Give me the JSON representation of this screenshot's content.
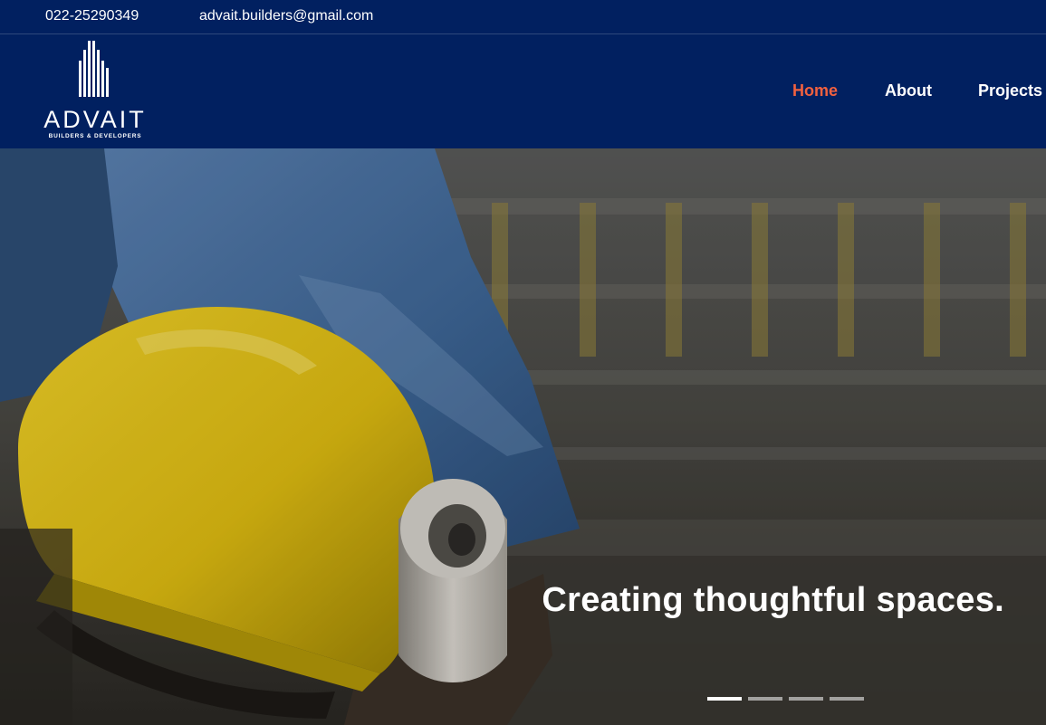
{
  "topbar": {
    "phone": "022-25290349",
    "email": "advait.builders@gmail.com"
  },
  "logo": {
    "brand": "ADVAIT",
    "tagline": "BUILDERS & DEVELOPERS"
  },
  "nav": {
    "items": [
      {
        "label": "Home",
        "active": true
      },
      {
        "label": "About",
        "active": false
      },
      {
        "label": "Projects",
        "active": false
      }
    ]
  },
  "hero": {
    "caption": "Creating thoughtful spaces.",
    "slides_total": 4,
    "active_slide": 1
  },
  "colors": {
    "header_bg": "#012060",
    "nav_active": "#f2613f",
    "text": "#ffffff",
    "helmet": "#e5c415"
  }
}
